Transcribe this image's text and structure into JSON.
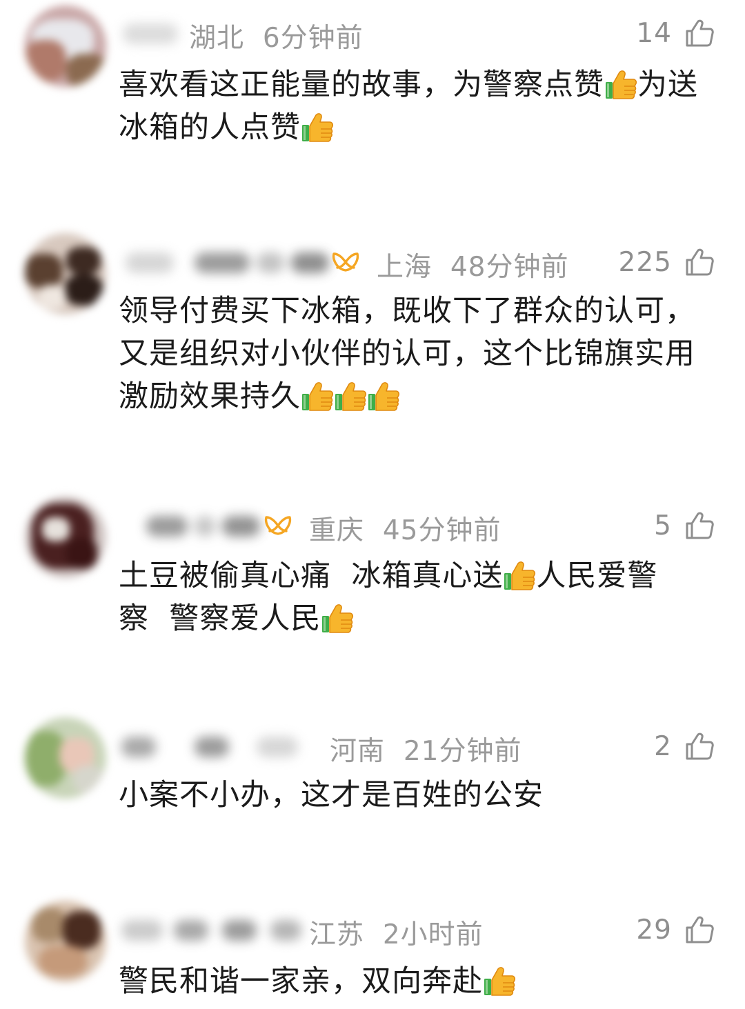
{
  "comments": [
    {
      "region": "湖北",
      "time": "6分钟前",
      "likes": "14",
      "has_vip": false,
      "lines": [
        "喜欢看这正能量的故事，为警察点赞",
        "为送",
        "冰箱的人点赞"
      ],
      "text_parts": [
        {
          "t": "喜欢看这正能量的故事，为警察点赞"
        },
        {
          "e": "thumbs-up"
        },
        {
          "t": "为送"
        },
        {
          "br": true
        },
        {
          "t": "冰箱的人点赞"
        },
        {
          "e": "thumbs-up"
        }
      ]
    },
    {
      "region": "上海",
      "time": "48分钟前",
      "likes": "225",
      "has_vip": true,
      "text_parts": [
        {
          "t": "领导付费买下冰箱，既收下了群众的认可，"
        },
        {
          "br": true
        },
        {
          "t": "又是组织对小伙伴的认可，这个比锦旗实用"
        },
        {
          "br": true
        },
        {
          "t": "激励效果持久"
        },
        {
          "e": "thumbs-up"
        },
        {
          "e": "thumbs-up"
        },
        {
          "e": "thumbs-up"
        }
      ]
    },
    {
      "region": "重庆",
      "time": "45分钟前",
      "likes": "5",
      "has_vip": true,
      "text_parts": [
        {
          "t": "土豆被偷真心痛  冰箱真心送"
        },
        {
          "e": "thumbs-up"
        },
        {
          "t": "人民爱警"
        },
        {
          "br": true
        },
        {
          "t": "察  警察爱人民"
        },
        {
          "e": "thumbs-up"
        }
      ]
    },
    {
      "region": "河南",
      "time": "21分钟前",
      "likes": "2",
      "has_vip": false,
      "text_parts": [
        {
          "t": "小案不小办，这才是百姓的公安"
        }
      ]
    },
    {
      "region": "江苏",
      "time": "2小时前",
      "likes": "29",
      "has_vip": false,
      "text_parts": [
        {
          "t": "警民和谐一家亲，双向奔赴"
        },
        {
          "e": "thumbs-up"
        }
      ]
    }
  ],
  "icons": {
    "like": "thumb-up-outline-icon",
    "vip": "vip-badge-icon",
    "emoji": "thumbs-up-emoji"
  },
  "colors": {
    "meta_text": "#9a9a9a",
    "body_text": "#1b1b1b",
    "vip_orange": "#f5a623",
    "emoji_yellow": "#f7b52c",
    "emoji_green": "#3fae49"
  }
}
